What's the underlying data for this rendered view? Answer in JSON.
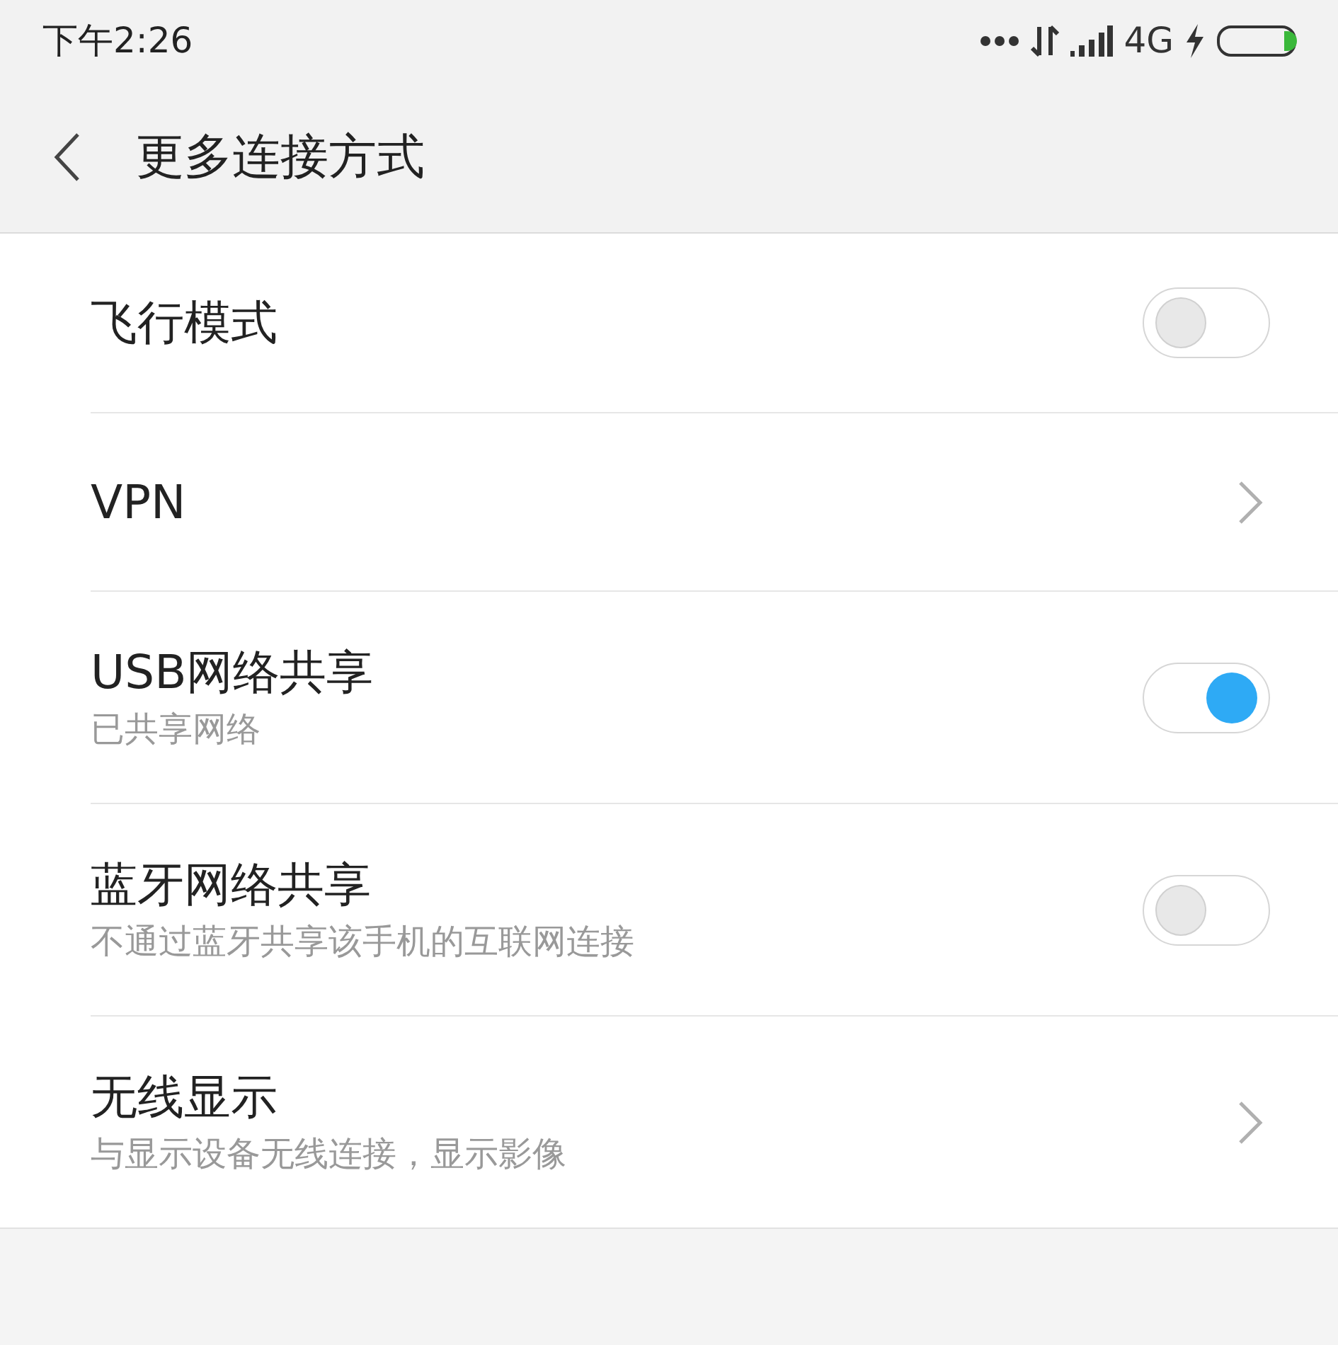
{
  "status_bar": {
    "time": "下午2:26",
    "network": "4G"
  },
  "header": {
    "title": "更多连接方式"
  },
  "items": [
    {
      "kind": "toggle",
      "title": "飞行模式",
      "on": false
    },
    {
      "kind": "link",
      "title": "VPN"
    },
    {
      "kind": "toggle",
      "title": "USB网络共享",
      "subtitle": "已共享网络",
      "on": true
    },
    {
      "kind": "toggle",
      "title": "蓝牙网络共享",
      "subtitle": "不通过蓝牙共享该手机的互联网连接",
      "on": false
    },
    {
      "kind": "link",
      "title": "无线显示",
      "subtitle": "与显示设备无线连接，显示影像"
    }
  ]
}
